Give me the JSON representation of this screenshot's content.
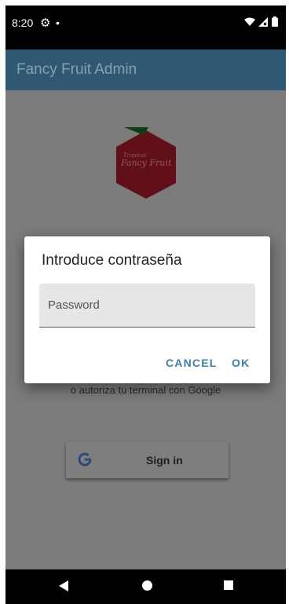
{
  "status_bar": {
    "time": "8:20",
    "settings_icon": "gear-icon",
    "notification_icon": "dot-icon",
    "wifi_icon": "wifi-icon",
    "signal_icon": "signal-icon",
    "battery_icon": "battery-icon"
  },
  "app_bar": {
    "title": "Fancy Fruit Admin"
  },
  "logo": {
    "line1": "Tropical",
    "line2": "Fancy Fruit",
    "color": "#c0182c",
    "leaf_color": "#1f7a2c"
  },
  "main": {
    "subtitle": "o autoriza tu terminal con Google",
    "signin_label": "Sign in",
    "google_icon": "google-g-icon"
  },
  "dialog": {
    "title": "Introduce contraseña",
    "password_placeholder": "Password",
    "password_value": "",
    "cancel_label": "CANCEL",
    "ok_label": "OK"
  },
  "nav_bar": {
    "back_icon": "back-triangle-icon",
    "home_icon": "home-circle-icon",
    "recents_icon": "recents-square-icon"
  },
  "colors": {
    "app_bar": "#2f5872",
    "accent": "#3c80a6",
    "scrim_background": "#7b7b7b"
  }
}
